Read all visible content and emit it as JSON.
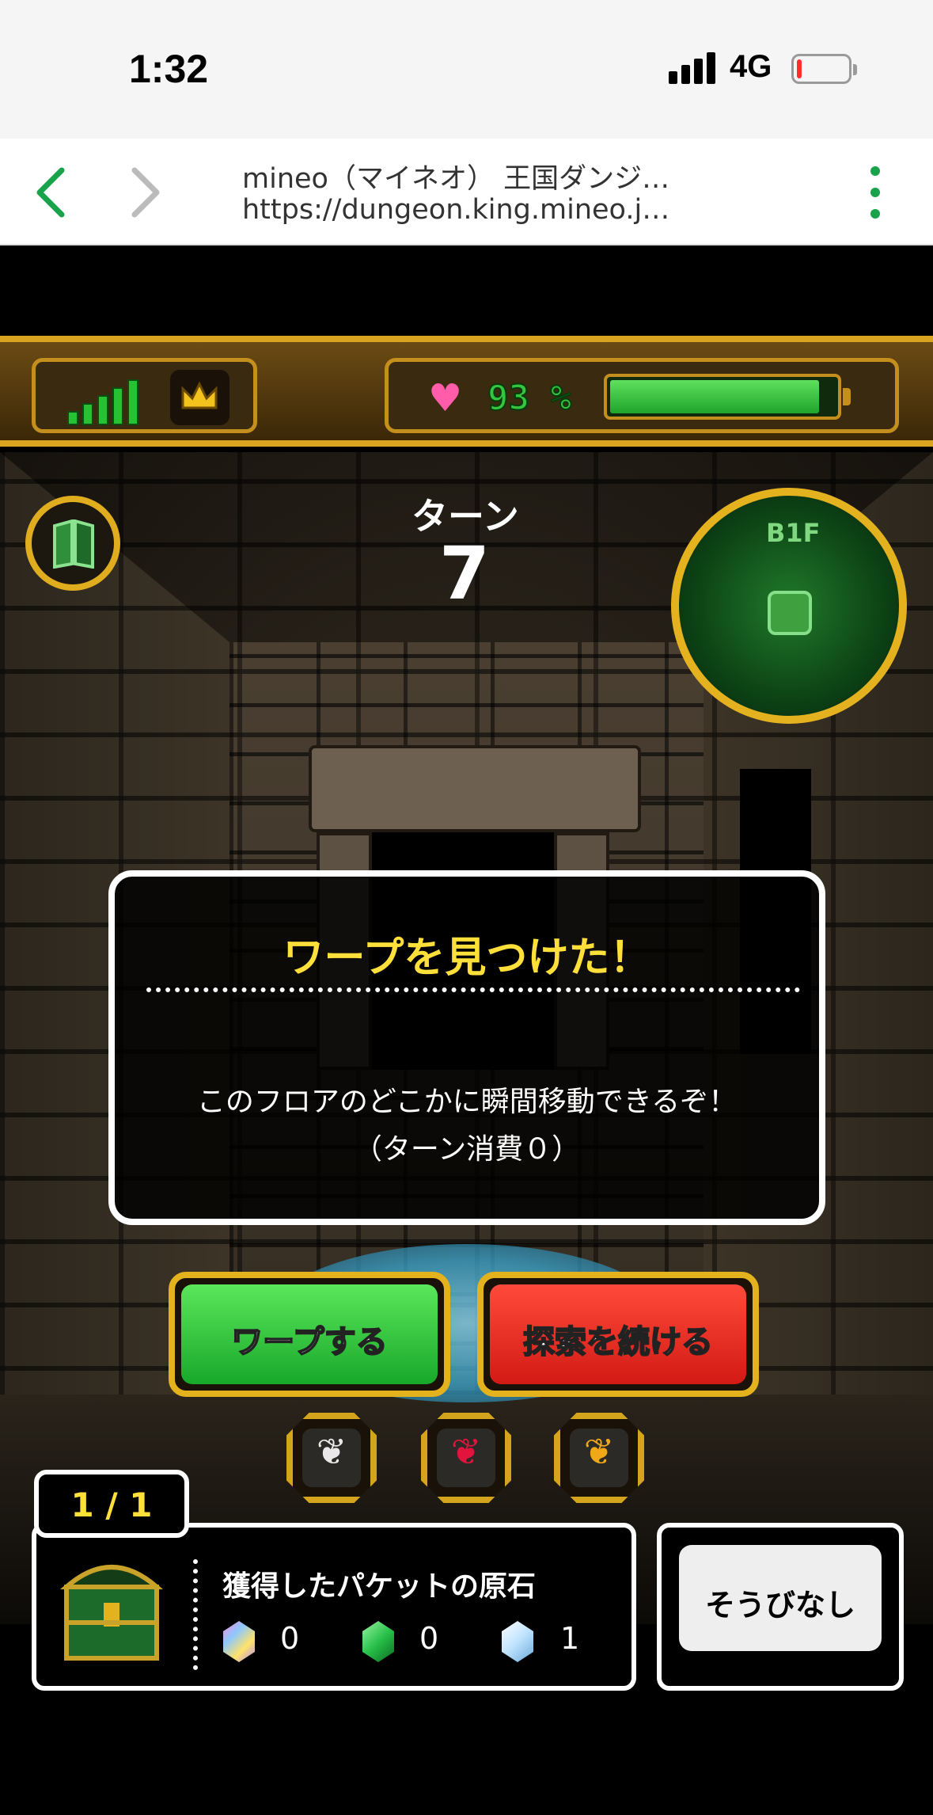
{
  "status_bar": {
    "time": "1:32",
    "network": "4G",
    "battery_level": 0.1
  },
  "browser": {
    "page_title": "mineo（マイネオ） 王国ダンジ…",
    "url": "https://dungeon.king.mineo.j…"
  },
  "hud": {
    "signal_bars": 5,
    "hp_percent_text": "93 %",
    "hp_level": 0.93
  },
  "game": {
    "turn_label": "ターン",
    "turn_number": "7",
    "floor": "B1F"
  },
  "dialog": {
    "title": "ワープを見つけた！",
    "body_line1": "このフロアのどこかに瞬間移動できるぞ！",
    "body_line2": "（ターン消費０）"
  },
  "buttons": {
    "warp": "ワープする",
    "explore": "探索を続ける"
  },
  "items": [
    "white-bean-icon",
    "red-bean-icon",
    "yellow-bean-icon"
  ],
  "treasure": {
    "counter": "1 / 1",
    "title": "獲得したパケットの原石",
    "gems": [
      {
        "icon": "rainbow-gem-icon",
        "count": "0",
        "color": "#b38cff"
      },
      {
        "icon": "green-gem-icon",
        "count": "0",
        "color": "#29c24a"
      },
      {
        "icon": "blue-gem-icon",
        "count": "1",
        "color": "#bfe3ff"
      }
    ]
  },
  "equipment": {
    "label": "そうびなし"
  },
  "colors": {
    "accent_gold": "#e3b21c",
    "hp_green": "#35c53f",
    "title_yellow": "#ffe03a",
    "browser_green": "#18a34a"
  }
}
